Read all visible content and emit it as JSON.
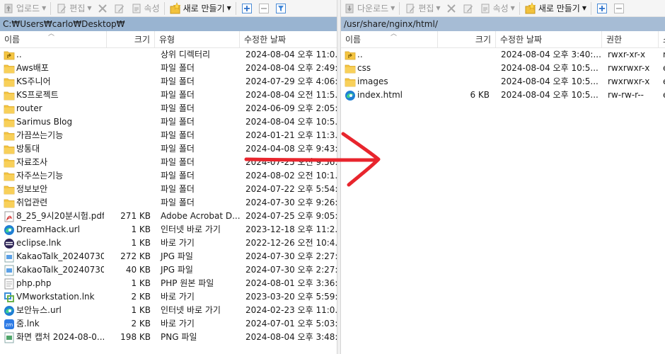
{
  "colors": {
    "left_path_bg": "#99b4d1",
    "right_path_bg": "#a6bcd5",
    "folder": "#f5c542",
    "annotation_arrow": "#e8252d"
  },
  "left": {
    "toolbar": {
      "upload_label": "업로드",
      "edit_label": "편집",
      "props_label": "속성",
      "new_label": "새로 만들기"
    },
    "path": "C:₩Users₩carlo₩Desktop₩",
    "headers": {
      "name": "이름",
      "size": "크기",
      "type": "유형",
      "modified": "수정한 날짜"
    },
    "files": [
      {
        "icon": "parent-dir-icon",
        "name": "..",
        "size": "",
        "type": "상위 디렉터리",
        "modified": "2024-08-04 오후 11:0..."
      },
      {
        "icon": "folder-icon",
        "name": "Aws배포",
        "size": "",
        "type": "파일 폴더",
        "modified": "2024-08-04 오후 2:49:"
      },
      {
        "icon": "folder-icon",
        "name": "KS주니어",
        "size": "",
        "type": "파일 폴더",
        "modified": "2024-07-29 오후 4:06:"
      },
      {
        "icon": "folder-icon",
        "name": "KS프로젝트",
        "size": "",
        "type": "파일 폴더",
        "modified": "2024-08-04 오전 11:5..."
      },
      {
        "icon": "folder-icon",
        "name": "router",
        "size": "",
        "type": "파일 폴더",
        "modified": "2024-06-09 오후 2:05:"
      },
      {
        "icon": "folder-icon",
        "name": "Sarimus Blog",
        "size": "",
        "type": "파일 폴더",
        "modified": "2024-08-04 오후 10:5..."
      },
      {
        "icon": "folder-icon",
        "name": "가끔쓰는기능",
        "size": "",
        "type": "파일 폴더",
        "modified": "2024-01-21 오후 11:3..."
      },
      {
        "icon": "folder-icon",
        "name": "방통대",
        "size": "",
        "type": "파일 폴더",
        "modified": "2024-04-08 오후 9:43:"
      },
      {
        "icon": "folder-icon",
        "name": "자료조사",
        "size": "",
        "type": "파일 폴더",
        "modified": "2024-07-25 오전 9:56:"
      },
      {
        "icon": "folder-icon",
        "name": "자주쓰는기능",
        "size": "",
        "type": "파일 폴더",
        "modified": "2024-08-02 오전 10:1..."
      },
      {
        "icon": "folder-icon",
        "name": "정보보안",
        "size": "",
        "type": "파일 폴더",
        "modified": "2024-07-22 오후 5:54:"
      },
      {
        "icon": "folder-icon",
        "name": "취업관련",
        "size": "",
        "type": "파일 폴더",
        "modified": "2024-07-30 오후 9:26:"
      },
      {
        "icon": "pdf-icon",
        "name": "8_25_9시20분시험.pdf",
        "size": "271 KB",
        "type": "Adobe Acrobat D...",
        "modified": "2024-07-25 오후 9:05:"
      },
      {
        "icon": "edge-url-icon",
        "name": "DreamHack.url",
        "size": "1 KB",
        "type": "인터넷 바로 가기",
        "modified": "2023-12-18 오후 11:2..."
      },
      {
        "icon": "eclipse-icon",
        "name": "eclipse.lnk",
        "size": "1 KB",
        "type": "바로 가기",
        "modified": "2022-12-26 오전 10:4..."
      },
      {
        "icon": "image-file-icon",
        "name": "KakaoTalk_20240730...",
        "size": "272 KB",
        "type": "JPG 파일",
        "modified": "2024-07-30 오후 2:27:"
      },
      {
        "icon": "image-file-icon",
        "name": "KakaoTalk_20240730...",
        "size": "40 KB",
        "type": "JPG 파일",
        "modified": "2024-07-30 오후 2:27:"
      },
      {
        "icon": "php-file-icon",
        "name": "php.php",
        "size": "1 KB",
        "type": "PHP 원본 파일",
        "modified": "2024-08-01 오후 3:36:"
      },
      {
        "icon": "vmware-icon",
        "name": "VMworkstation.lnk",
        "size": "2 KB",
        "type": "바로 가기",
        "modified": "2023-03-20 오후 5:59:"
      },
      {
        "icon": "edge-url-icon",
        "name": "보안뉴스.url",
        "size": "1 KB",
        "type": "인터넷 바로 가기",
        "modified": "2024-02-23 오후 11:0..."
      },
      {
        "icon": "shortcut-app-icon",
        "name": "줌.lnk",
        "size": "2 KB",
        "type": "바로 가기",
        "modified": "2024-07-01 오후 5:03:"
      },
      {
        "icon": "png-file-icon",
        "name": "화면 캡처 2024-08-0...",
        "size": "198 KB",
        "type": "PNG 파일",
        "modified": "2024-08-04 오후 3:48:"
      }
    ]
  },
  "right": {
    "toolbar": {
      "download_label": "다운로드",
      "edit_label": "편집",
      "props_label": "속성",
      "new_label": "새로 만들기"
    },
    "path": "/usr/share/nginx/html/",
    "headers": {
      "name": "이름",
      "size": "크기",
      "modified": "수정한 날짜",
      "perms": "권한",
      "owner": "소"
    },
    "files": [
      {
        "icon": "parent-dir-icon",
        "name": "..",
        "size": "",
        "modified": "2024-08-04 오후 3:40:...",
        "perms": "rwxr-xr-x",
        "owner": "r"
      },
      {
        "icon": "folder-icon",
        "name": "css",
        "size": "",
        "modified": "2024-08-04 오후 10:5...",
        "perms": "rwxrwxr-x",
        "owner": "e"
      },
      {
        "icon": "folder-icon",
        "name": "images",
        "size": "",
        "modified": "2024-08-04 오후 10:5...",
        "perms": "rwxrwxr-x",
        "owner": "e"
      },
      {
        "icon": "edge-html-icon",
        "name": "index.html",
        "size": "6 KB",
        "modified": "2024-08-04 오후 10:5...",
        "perms": "rw-rw-r--",
        "owner": "e"
      }
    ]
  }
}
